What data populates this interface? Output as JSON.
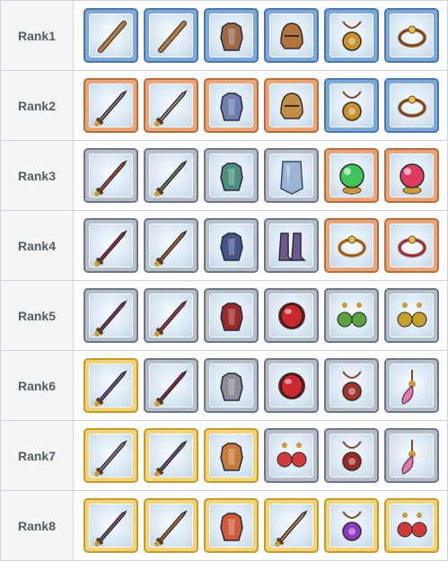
{
  "rows": [
    {
      "label": "Rank1",
      "items": [
        {
          "tier": "blue",
          "icon": "wooden-stick-icon",
          "color": "#b07a4a"
        },
        {
          "tier": "blue",
          "icon": "wooden-stick-icon",
          "color": "#b07a4a"
        },
        {
          "tier": "blue",
          "icon": "leather-armor-icon",
          "color": "#9a6a48"
        },
        {
          "tier": "blue",
          "icon": "leather-cap-icon",
          "color": "#b0743f"
        },
        {
          "tier": "blue",
          "icon": "clover-amulet-icon",
          "color": "#c8902f"
        },
        {
          "tier": "blue",
          "icon": "braided-bracelet-icon",
          "color": "#a6683a"
        }
      ]
    },
    {
      "label": "Rank2",
      "items": [
        {
          "tier": "copper",
          "icon": "spear-icon",
          "color": "#8a8f99"
        },
        {
          "tier": "copper",
          "icon": "sword-icon",
          "color": "#a8a9b0"
        },
        {
          "tier": "copper",
          "icon": "plate-armor-icon",
          "color": "#6d7fae"
        },
        {
          "tier": "copper",
          "icon": "knight-helmet-icon",
          "color": "#c08c4a"
        },
        {
          "tier": "blue",
          "icon": "clover-amulet-icon",
          "color": "#c8902f"
        },
        {
          "tier": "blue",
          "icon": "braided-bracelet-icon",
          "color": "#a6683a"
        }
      ]
    },
    {
      "label": "Rank3",
      "items": [
        {
          "tier": "silver",
          "icon": "spear-icon",
          "color": "#c25b3b"
        },
        {
          "tier": "silver",
          "icon": "spear-icon",
          "color": "#5f9c6e"
        },
        {
          "tier": "silver",
          "icon": "chest-armor-icon",
          "color": "#4c8f7e"
        },
        {
          "tier": "silver",
          "icon": "shield-icon",
          "color": "#9bb4d2"
        },
        {
          "tier": "copper",
          "icon": "green-orb-icon",
          "color": "#3fc45a"
        },
        {
          "tier": "copper",
          "icon": "red-orb-icon",
          "color": "#e03a60"
        }
      ]
    },
    {
      "label": "Rank4",
      "items": [
        {
          "tier": "silver",
          "icon": "curved-blade-icon",
          "color": "#a8304a"
        },
        {
          "tier": "silver",
          "icon": "spear-icon",
          "color": "#c47436"
        },
        {
          "tier": "silver",
          "icon": "dark-armor-icon",
          "color": "#46528a"
        },
        {
          "tier": "silver",
          "icon": "boots-icon",
          "color": "#6b5a8a"
        },
        {
          "tier": "copper",
          "icon": "gem-bracelet-icon",
          "color": "#d0893a"
        },
        {
          "tier": "copper",
          "icon": "studded-collar-icon",
          "color": "#c44a52"
        }
      ]
    },
    {
      "label": "Rank5",
      "items": [
        {
          "tier": "silver",
          "icon": "crystal-sword-icon",
          "color": "#8a3a8a"
        },
        {
          "tier": "silver",
          "icon": "curved-blade-icon",
          "color": "#b0405c"
        },
        {
          "tier": "silver",
          "icon": "cloak-armor-icon",
          "color": "#9a2a2a"
        },
        {
          "tier": "silver",
          "icon": "ruby-disc-icon",
          "color": "#c8282e"
        },
        {
          "tier": "silver",
          "icon": "green-earrings-icon",
          "color": "#5aa23c"
        },
        {
          "tier": "silver",
          "icon": "gold-earrings-icon",
          "color": "#c8a02a"
        }
      ]
    },
    {
      "label": "Rank6",
      "items": [
        {
          "tier": "gold",
          "icon": "sun-blade-icon",
          "color": "#6a6ab0"
        },
        {
          "tier": "silver",
          "icon": "crystal-sword-icon",
          "color": "#8a2a5a"
        },
        {
          "tier": "silver",
          "icon": "mech-armor-icon",
          "color": "#8c8c94"
        },
        {
          "tier": "silver",
          "icon": "ruby-disc-icon",
          "color": "#c8282e"
        },
        {
          "tier": "silver",
          "icon": "ornate-pendant-icon",
          "color": "#a0342e"
        },
        {
          "tier": "silver",
          "icon": "feather-charm-icon",
          "color": "#e07ab0"
        }
      ]
    },
    {
      "label": "Rank7",
      "items": [
        {
          "tier": "gold",
          "icon": "jagged-sword-icon",
          "color": "#8a96b0"
        },
        {
          "tier": "gold",
          "icon": "sun-blade-icon",
          "color": "#5a6ab0"
        },
        {
          "tier": "gold",
          "icon": "royal-armor-icon",
          "color": "#c87a3a"
        },
        {
          "tier": "silver",
          "icon": "ruby-earrings-icon",
          "color": "#d03a3a"
        },
        {
          "tier": "silver",
          "icon": "lion-pendant-icon",
          "color": "#9a2a2a"
        },
        {
          "tier": "silver",
          "icon": "feather-charm-icon",
          "color": "#e07ab0"
        }
      ]
    },
    {
      "label": "Rank8",
      "items": [
        {
          "tier": "gold",
          "icon": "jagged-sword-icon",
          "color": "#7a6a90"
        },
        {
          "tier": "gold",
          "icon": "serrated-sword-icon",
          "color": "#c08a3a"
        },
        {
          "tier": "gold",
          "icon": "royal-dress-icon",
          "color": "#d05a3a"
        },
        {
          "tier": "gold",
          "icon": "golden-scimitar-icon",
          "color": "#d4a24a"
        },
        {
          "tier": "gold",
          "icon": "amethyst-pendant-icon",
          "color": "#8a3ac4"
        },
        {
          "tier": "gold",
          "icon": "ruby-earrings-icon",
          "color": "#d03a3a"
        }
      ]
    }
  ]
}
